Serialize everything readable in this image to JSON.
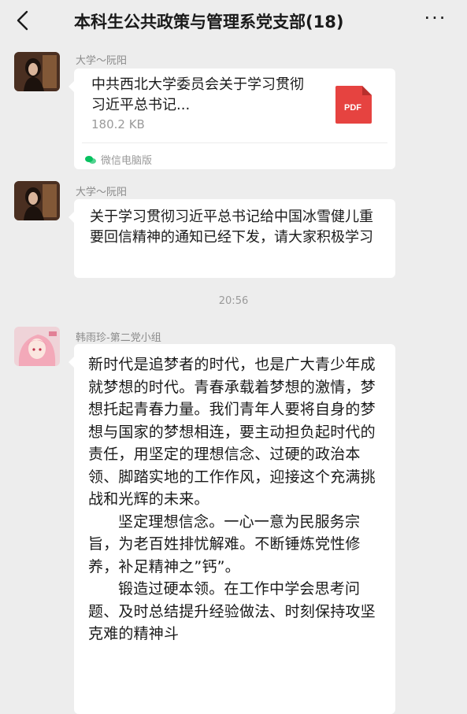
{
  "header": {
    "title": "本科生公共政策与管理系党支部(18)",
    "back_icon": "chevron-left-icon",
    "more_label": "···"
  },
  "messages": [
    {
      "sender": "大学～阮阳",
      "type": "file",
      "file_title": "中共西北大学委员会关于学习贯彻习近平总书记...",
      "file_size": "180.2 KB",
      "file_type_label": "PDF",
      "source": "微信电脑版"
    },
    {
      "sender": "大学～阮阳",
      "type": "text",
      "text": "关于学习贯彻习近平总书记给中国冰雪健儿重要回信精神的通知已经下发，请大家积极学习"
    },
    {
      "timestamp": "20:56"
    },
    {
      "sender": "韩雨珍-第二党小组",
      "type": "text",
      "paragraphs": [
        "新时代是追梦者的时代，也是广大青少年成就梦想的时代。青春承载着梦想的激情，梦想托起青春力量。我们青年人要将自身的梦想与国家的梦想相连，要主动担负起时代的责任，用坚定的理想信念、过硬的政治本领、脚踏实地的工作作风，迎接这个充满挑战和光辉的未来。",
        "坚定理想信念。一心一意为民服务宗旨，为老百姓排忧解难。不断锤炼党性修养，补足精神之”钙”。",
        "锻造过硬本领。在工作中学会思考问题、及时总结提升经验做法、时刻保持攻坚克难的精神斗"
      ]
    }
  ],
  "colors": {
    "background": "#ededed",
    "bubble": "#ffffff",
    "pdf_red": "#e64340",
    "wechat_green": "#07c160"
  }
}
